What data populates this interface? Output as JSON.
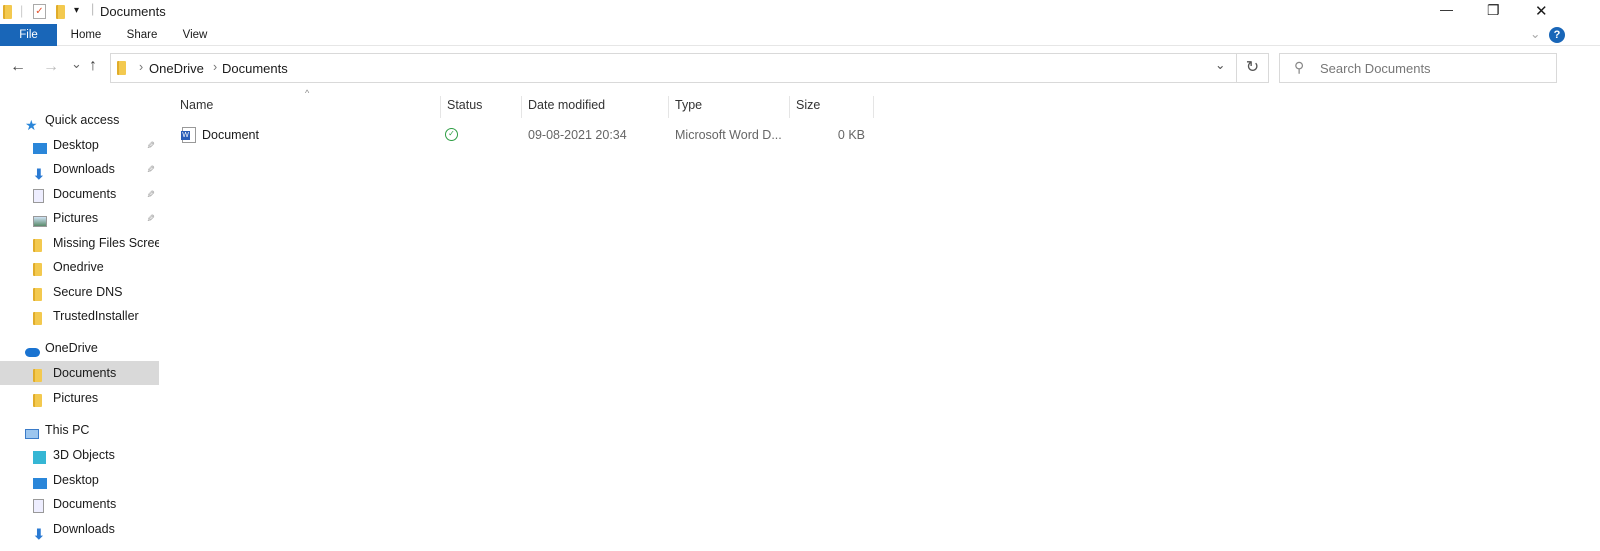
{
  "window": {
    "title": "Documents",
    "minimize": "—",
    "restore": "❐",
    "close": "✕"
  },
  "ribbon": {
    "tabs": [
      "File",
      "Home",
      "Share",
      "View"
    ],
    "help": "?"
  },
  "nav": {
    "back": "←",
    "forward": "→",
    "recent": "⌄",
    "up": "↑",
    "dropdown": "⌄",
    "refresh": "↻"
  },
  "breadcrumb": [
    "OneDrive",
    "Documents"
  ],
  "search": {
    "placeholder": "Search Documents"
  },
  "sidebar": [
    {
      "label": "Quick access",
      "icon": "star",
      "level": 0,
      "pinned": false
    },
    {
      "label": "Desktop",
      "icon": "desktop",
      "level": 1,
      "pinned": true
    },
    {
      "label": "Downloads",
      "icon": "download",
      "level": 1,
      "pinned": true
    },
    {
      "label": "Documents",
      "icon": "document",
      "level": 1,
      "pinned": true
    },
    {
      "label": "Pictures",
      "icon": "pictures",
      "level": 1,
      "pinned": true
    },
    {
      "label": "Missing Files Screen",
      "icon": "folder",
      "level": 1,
      "pinned": false
    },
    {
      "label": "Onedrive",
      "icon": "folder",
      "level": 1,
      "pinned": false
    },
    {
      "label": "Secure DNS",
      "icon": "folder",
      "level": 1,
      "pinned": false
    },
    {
      "label": "TrustedInstaller",
      "icon": "folder",
      "level": 1,
      "pinned": false
    },
    {
      "label": "OneDrive",
      "icon": "cloud",
      "level": 0,
      "pinned": false
    },
    {
      "label": "Documents",
      "icon": "folder",
      "level": 1,
      "pinned": false,
      "selected": true
    },
    {
      "label": "Pictures",
      "icon": "folder",
      "level": 1,
      "pinned": false
    },
    {
      "label": "This PC",
      "icon": "pc",
      "level": 0,
      "pinned": false
    },
    {
      "label": "3D Objects",
      "icon": "cube",
      "level": 1,
      "pinned": false
    },
    {
      "label": "Desktop",
      "icon": "desktop",
      "level": 1,
      "pinned": false
    },
    {
      "label": "Documents",
      "icon": "document",
      "level": 1,
      "pinned": false
    },
    {
      "label": "Downloads",
      "icon": "download",
      "level": 1,
      "pinned": false
    }
  ],
  "columns": [
    "Name",
    "Status",
    "Date modified",
    "Type",
    "Size"
  ],
  "files": [
    {
      "name": "Document",
      "status": "synced",
      "date": "09-08-2021 20:34",
      "type": "Microsoft Word D...",
      "size": "0 KB"
    }
  ],
  "colors": {
    "accent": "#1966b8",
    "folder": "#f3c94f",
    "selected": "#d9d9d9"
  }
}
